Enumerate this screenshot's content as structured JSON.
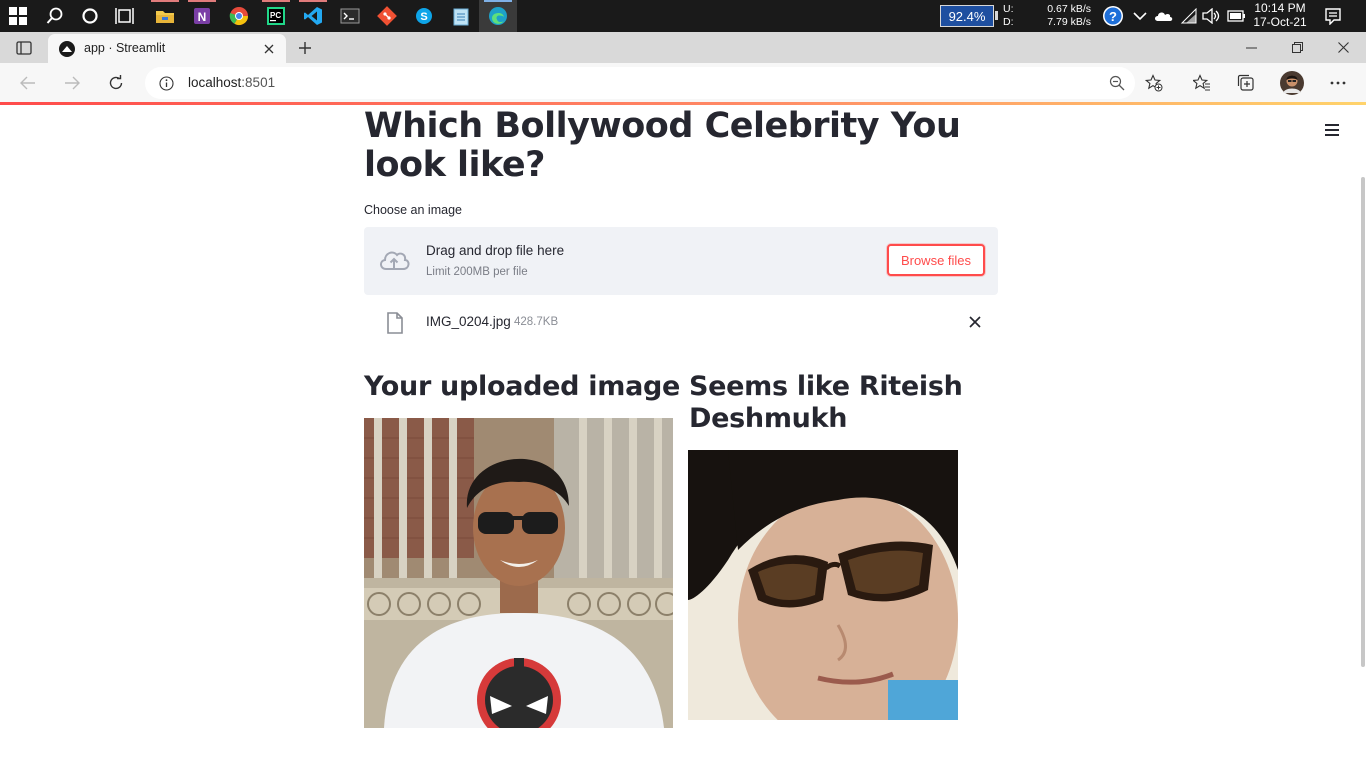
{
  "taskbar": {
    "battery": "92.4%",
    "net_upload_label": "U:",
    "net_download_label": "D:",
    "net_upload_rate": "0.67 kB/s",
    "net_download_rate": "7.79 kB/s",
    "clock_time": "10:14 PM",
    "clock_date": "17-Oct-21",
    "pinned_icons": [
      "start-icon",
      "search-icon",
      "cortana-icon",
      "task-view-icon",
      "file-explorer-icon",
      "onenote-icon",
      "chrome-icon",
      "pycharm-icon",
      "vscode-icon",
      "terminal-icon",
      "git-icon",
      "skype-icon",
      "notepad-icon",
      "edge-icon"
    ]
  },
  "browser": {
    "tab_title": "app · Streamlit",
    "address": "localhost",
    "port": ":8501"
  },
  "app": {
    "title": "Which Bollywood Celebrity You look like?",
    "uploader_label": "Choose an image",
    "uploader_main_text": "Drag and drop file here",
    "uploader_limit_text": "Limit 200MB per file",
    "browse_button": "Browse files",
    "uploaded_file_name": "IMG_0204.jpg",
    "uploaded_file_size": "428.7KB",
    "col1_heading": "Your uploaded image",
    "col2_heading": "Seems like Riteish Deshmukh"
  },
  "colors": {
    "accent": "#ff4b4b",
    "text": "#262730",
    "uploader_bg": "#f0f2f6",
    "taskbar_bg": "#1a1a1a"
  }
}
